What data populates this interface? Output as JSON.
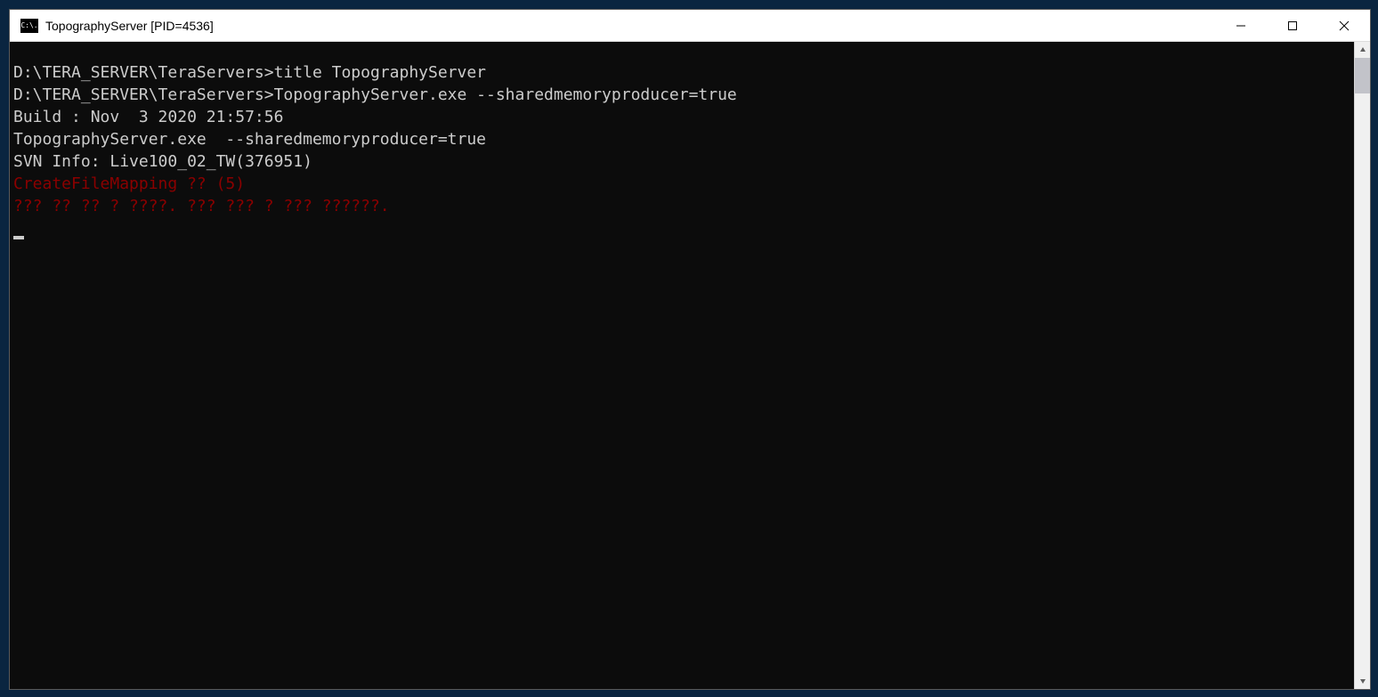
{
  "window": {
    "title": "TopographyServer [PID=4536]",
    "icon_label": "C:\\."
  },
  "terminal": {
    "lines": [
      {
        "text": "D:\\TERA_SERVER\\TeraServers>title TopographyServer",
        "cls": "prompt"
      },
      {
        "text": "",
        "cls": ""
      },
      {
        "text": "D:\\TERA_SERVER\\TeraServers>TopographyServer.exe --sharedmemoryproducer=true",
        "cls": "prompt"
      },
      {
        "text": "Build : Nov  3 2020 21:57:56",
        "cls": ""
      },
      {
        "text": "TopographyServer.exe  --sharedmemoryproducer=true",
        "cls": ""
      },
      {
        "text": "SVN Info: Live100_02_TW(376951)",
        "cls": ""
      },
      {
        "text": "CreateFileMapping ?? (5)",
        "cls": "err"
      },
      {
        "text": "??? ?? ?? ? ????. ??? ??? ? ??? ??????.",
        "cls": "err"
      }
    ]
  }
}
